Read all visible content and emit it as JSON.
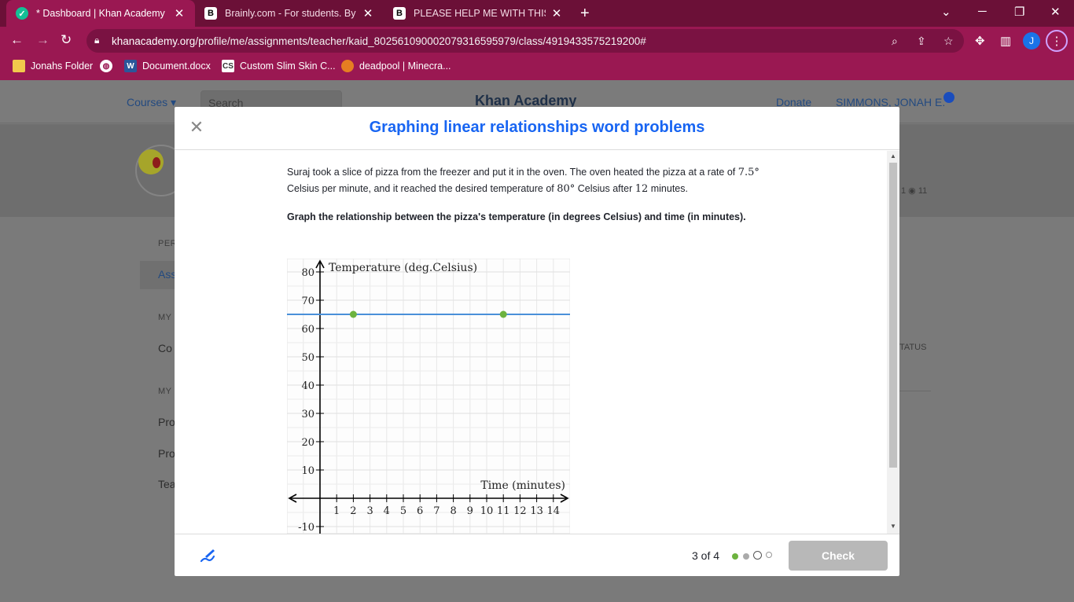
{
  "browser": {
    "tabs": [
      {
        "title": "* Dashboard | Khan Academy",
        "active": true,
        "icon": "khan-academy-favicon"
      },
      {
        "title": "Brainly.com - For students. By stu",
        "active": false,
        "icon": "brainly-favicon"
      },
      {
        "title": "PLEASE HELP ME WITH THIS KHA",
        "active": false,
        "icon": "brainly-favicon"
      }
    ],
    "url_host": "khanacademy.org",
    "url_path": "/profile/me/assignments/teacher/kaid_802561090002079316595979/class/4919433575219200#",
    "profile_initial": "J",
    "bookmarks": [
      {
        "label": "Jonahs Folder",
        "icon": "folder-icon"
      },
      {
        "label": "",
        "icon": "globe-icon"
      },
      {
        "label": "Document.docx",
        "icon": "word-icon"
      },
      {
        "label": "Custom Slim Skin C...",
        "icon": "cs-icon"
      },
      {
        "label": "deadpool | Minecra...",
        "icon": "pumpkin-icon"
      }
    ],
    "accent": "#9a1852"
  },
  "background_page": {
    "courses": "Courses ▾",
    "search_placeholder": "Search",
    "logo": "Khan Academy",
    "donate": "Donate",
    "user": "SIMMONS, JONAH E.",
    "side_items": [
      "PER",
      "Ass",
      "MY",
      "Co",
      "MY",
      "Pro",
      "Pro",
      "Tea"
    ],
    "status_header": "TATUS",
    "streak": "1 ◉ 11"
  },
  "modal": {
    "title": "Graphing linear relationships word problems",
    "problem_parts": {
      "p1": "Suraj took a slice of pizza from the freezer and put it in the oven. The oven heated the pizza at a rate of ",
      "rate": "7.5°",
      "p2": "Celsius per minute, and it reached the desired temperature of ",
      "temp": "80°",
      "p3": " Celsius after ",
      "minutes": "12",
      "p4": " minutes."
    },
    "prompt": "Graph the relationship between the pizza's temperature (in degrees Celsius) and time (in minutes).",
    "footer": {
      "progress": "3 of 4",
      "check_label": "Check"
    }
  },
  "chart_data": {
    "type": "line",
    "xlabel": "Time (minutes)",
    "ylabel": "Temperature (deg.Celsius)",
    "xlim": [
      -2,
      15
    ],
    "ylim": [
      -10,
      84
    ],
    "x_ticks": [
      1,
      2,
      3,
      4,
      5,
      6,
      7,
      8,
      9,
      10,
      11,
      12,
      13,
      14
    ],
    "y_ticks": [
      80,
      70,
      60,
      50,
      40,
      30,
      20,
      10,
      -10
    ],
    "grid": true,
    "line": {
      "y": 65,
      "color": "#4a90d9"
    },
    "points": [
      {
        "x": 2,
        "y": 65
      },
      {
        "x": 11,
        "y": 65
      }
    ],
    "point_color": "#6db33f"
  }
}
